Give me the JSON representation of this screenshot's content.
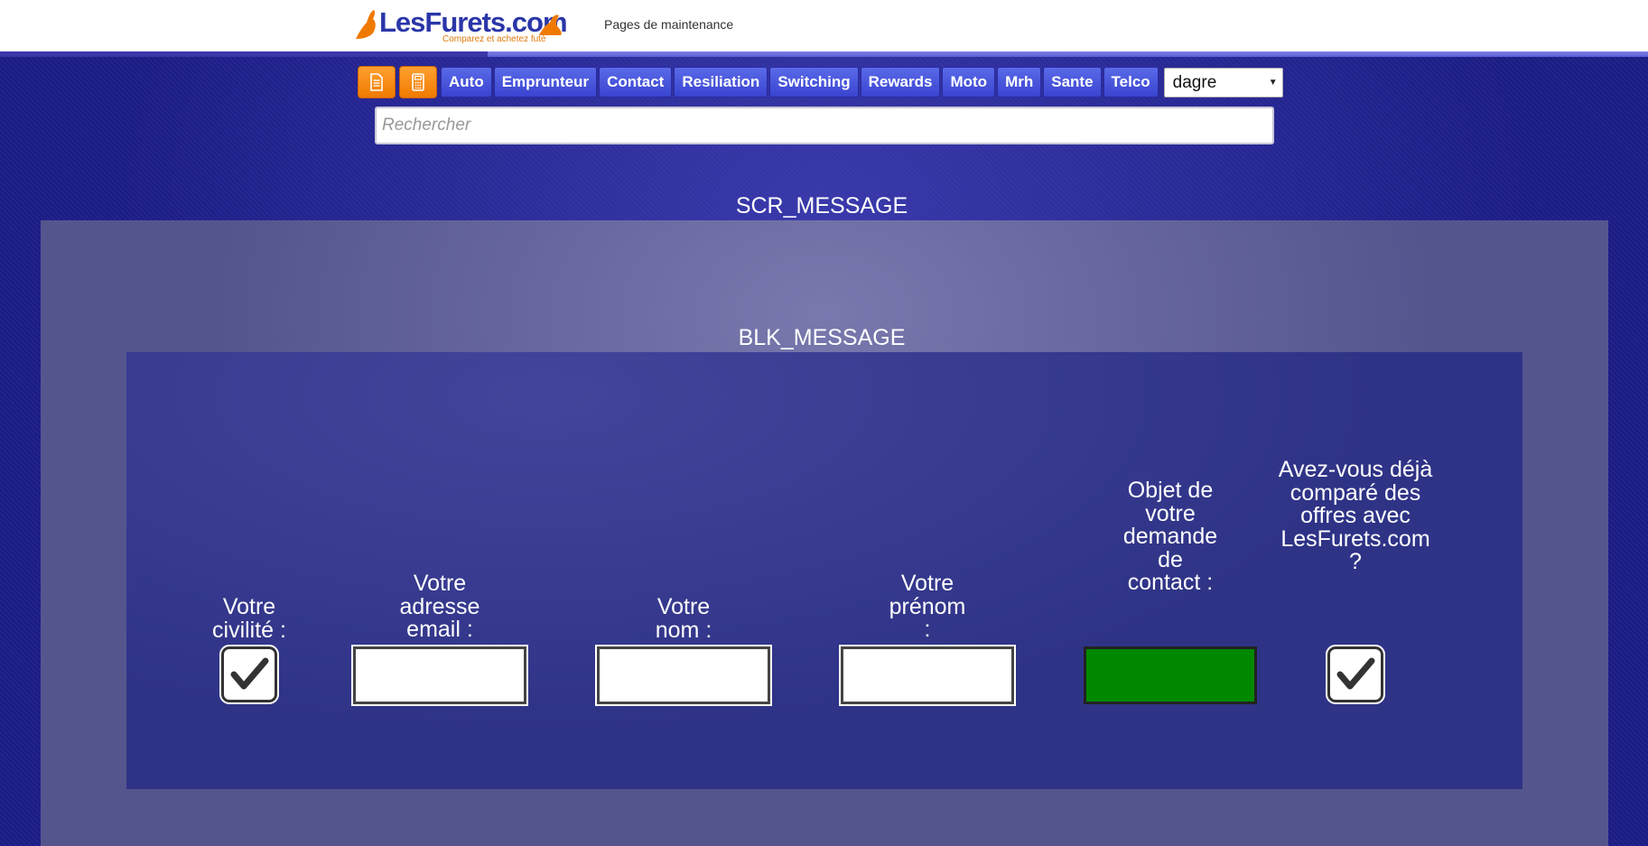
{
  "header": {
    "logo_text": "LesFurets.com",
    "logo_tagline": "Comparez et achetez futé",
    "title": "Pages de maintenance"
  },
  "nav": {
    "items": [
      "Auto",
      "Emprunteur",
      "Contact",
      "Resiliation",
      "Switching",
      "Rewards",
      "Moto",
      "Mrh",
      "Sante",
      "Telco"
    ],
    "select_value": "dagre"
  },
  "search": {
    "placeholder": "Rechercher"
  },
  "screen": {
    "title": "SCR_MESSAGE",
    "block_title": "BLK_MESSAGE"
  },
  "form": {
    "civilite_label": "Votre civilité :",
    "email_label": "Votre adresse email :",
    "nom_label": "Votre nom :",
    "prenom_label": "Votre prénom :",
    "objet_label": "Objet de votre demande de contact :",
    "compare_label": "Avez-vous déjà comparé des offres avec LesFurets.com ?"
  },
  "colors": {
    "background": "#1a1a85",
    "nav_button": "#4a56dc",
    "icon_button": "#f78a10",
    "panel": "#55558e",
    "block_panel": "#2f3386",
    "select_green": "#008800"
  }
}
